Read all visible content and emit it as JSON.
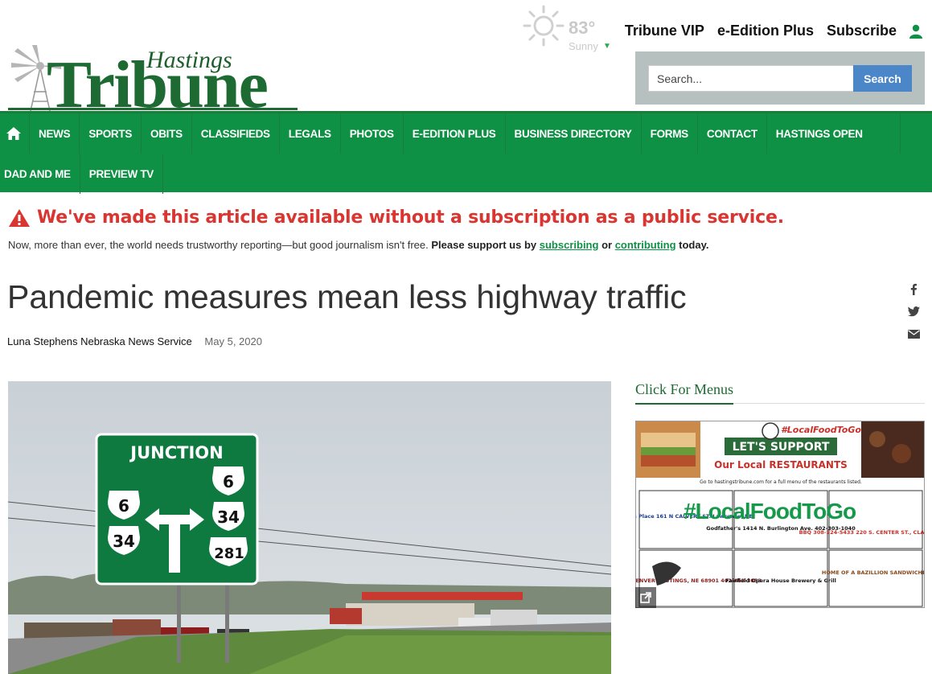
{
  "logo": {
    "small": "Hastings",
    "big": "Tribune"
  },
  "weather": {
    "temperature": "83°",
    "condition": "Sunny"
  },
  "topnav": {
    "vip": "Tribune VIP",
    "eedition": "e-Edition Plus",
    "subscribe": "Subscribe"
  },
  "search": {
    "placeholder": "Search...",
    "button": "Search"
  },
  "nav": {
    "row1": [
      "NEWS",
      "SPORTS",
      "OBITS",
      "CLASSIFIEDS",
      "LEGALS",
      "PHOTOS",
      "E-EDITION PLUS",
      "BUSINESS DIRECTORY",
      "FORMS",
      "CONTACT",
      "HASTINGS OPEN"
    ],
    "row2": [
      "DAD AND ME",
      "PREVIEW TV"
    ]
  },
  "notice": {
    "alert": "We've made this article available without a subscription as a public service.",
    "sub_text": "Now, more than ever, the world needs trustworthy reporting—but good journalism isn't free.",
    "support": "Please support us by",
    "link1": "subscribing",
    "or": "or",
    "link2": "contributing",
    "end": "today."
  },
  "article": {
    "headline": "Pandemic measures mean less highway traffic",
    "author": "Luna Stephens Nebraska News Service",
    "date": "May 5, 2020"
  },
  "photo": {
    "sign_title": "JUNCTION",
    "routes_left": [
      "6",
      "34"
    ],
    "routes_right": [
      "6",
      "34",
      "281"
    ]
  },
  "sidebar": {
    "title": "Click For Menus",
    "ad_overlay": "#LocalFoodToGo",
    "ad_tag": "#LocalFoodToGo",
    "ad_headline": "LET'S SUPPORT",
    "ad_sub": "Our Local RESTAURANTS",
    "ad_line": "Go to hastingstribune.com for a full menu of the restaurants listed.",
    "ad_items": [
      "Godfather's 1414 N. Burlington Ave. 402-303-1040",
      "Dick's Place 161 N CALVERT ST. Lawrence, NE",
      "BBQ 308-224-5433 220 S. CENTER ST., CLAY CENTER",
      "107 N. DENVER HASTINGS, NE 68901 402-463-3053",
      "Fairfield Opera House Brewery & Grill",
      "HOME OF A BAZILLION SANDWICHES"
    ]
  }
}
